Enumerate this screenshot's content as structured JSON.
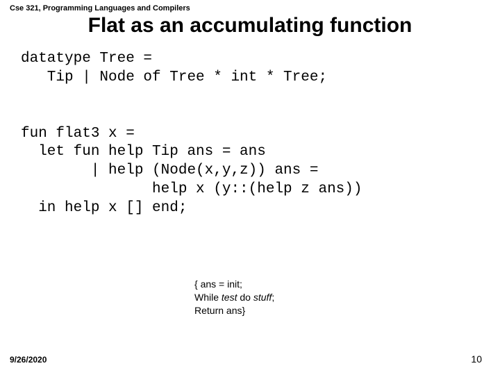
{
  "header": "Cse 321, Programming Languages and Compilers",
  "title": "Flat as an accumulating function",
  "code": {
    "l1": "datatype Tree =",
    "l2": "   Tip | Node of Tree * int * Tree;",
    "l3": "",
    "l4": "",
    "l5": "fun flat3 x =",
    "l6": "  let fun help Tip ans = ans",
    "l7": "        | help (Node(x,y,z)) ans =",
    "l8": "               help x (y::(help z ans))",
    "l9": "  in help x [] end;"
  },
  "note": {
    "l1a": "{ ans = init;",
    "l2a": "  While ",
    "l2b": "test",
    "l2c": " do ",
    "l2d": "stuff",
    "l2e": ";",
    "l3a": "  Return ans}"
  },
  "footer": {
    "date": "9/26/2020",
    "page": "10"
  }
}
